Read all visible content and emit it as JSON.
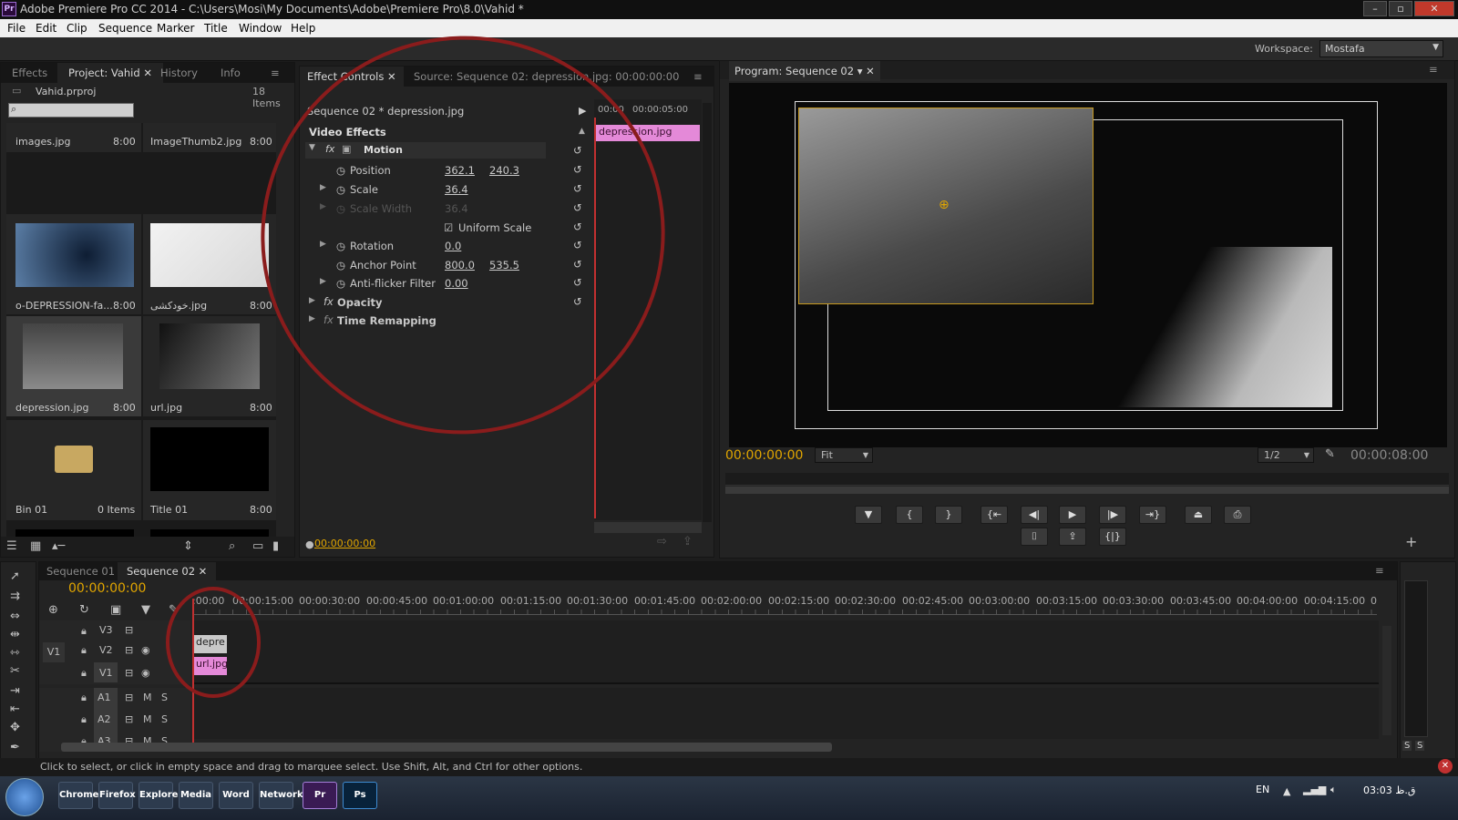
{
  "titlebar": {
    "title": "Adobe Premiere Pro CC 2014 - C:\\Users\\Mosi\\My Documents\\Adobe\\Premiere Pro\\8.0\\Vahid *",
    "app_icon": "Pr"
  },
  "menu": [
    "File",
    "Edit",
    "Clip",
    "Sequence",
    "Marker",
    "Title",
    "Window",
    "Help"
  ],
  "workspace": {
    "label": "Workspace:",
    "value": "Mostafa"
  },
  "project_panel": {
    "tabs": [
      "Effects",
      "Project: Vahid",
      "History",
      "Info"
    ],
    "project_file": "Vahid.prproj",
    "item_count": "18 Items",
    "items": [
      {
        "name": "images.jpg",
        "dur": "8:00"
      },
      {
        "name": "ImageThumb2.jpg",
        "dur": "8:00"
      },
      {
        "name": "o-DEPRESSION-fa...",
        "dur": "8:00"
      },
      {
        "name": "خودکشی.jpg",
        "dur": "8:00"
      },
      {
        "name": "depression.jpg",
        "dur": "8:00"
      },
      {
        "name": "url.jpg",
        "dur": "8:00"
      },
      {
        "name": "Bin 01",
        "dur": "0 Items"
      },
      {
        "name": "Title 01",
        "dur": "8:00"
      }
    ]
  },
  "effect_controls": {
    "tabs": [
      "Effect Controls",
      "Source: Sequence 02: depression.jpg: 00:00:00:00"
    ],
    "sequence_clip": "Sequence 02 * depression.jpg",
    "ruler": [
      "00:00",
      "00:00:05:00"
    ],
    "clip_label": "depression.jpg",
    "section": "Video Effects",
    "motion": "Motion",
    "position_label": "Position",
    "position_x": "362.1",
    "position_y": "240.3",
    "scale_label": "Scale",
    "scale": "36.4",
    "scale_width_label": "Scale Width",
    "scale_width": "36.4",
    "uniform_scale": "Uniform Scale",
    "rotation_label": "Rotation",
    "rotation": "0.0",
    "anchor_label": "Anchor Point",
    "anchor_x": "800.0",
    "anchor_y": "535.5",
    "antiflicker_label": "Anti-flicker Filter",
    "antiflicker": "0.00",
    "opacity": "Opacity",
    "time_remapping": "Time Remapping",
    "timecode": "00:00:00:00"
  },
  "program_monitor": {
    "tab": "Program: Sequence 02",
    "timecode": "00:00:00:00",
    "fit": "Fit",
    "resolution": "1/2",
    "duration": "00:00:08:00"
  },
  "timeline": {
    "tabs": [
      "Sequence 01",
      "Sequence 02"
    ],
    "timecode": "00:00:00:00",
    "ruler": [
      ":00:00",
      "00:00:15:00",
      "00:00:30:00",
      "00:00:45:00",
      "00:01:00:00",
      "00:01:15:00",
      "00:01:30:00",
      "00:01:45:00",
      "00:02:00:00",
      "00:02:15:00",
      "00:02:30:00",
      "00:02:45:00",
      "00:03:00:00",
      "00:03:15:00",
      "00:03:30:00",
      "00:03:45:00",
      "00:04:00:00",
      "00:04:15:00",
      "0"
    ],
    "video_tracks": [
      "V3",
      "V2",
      "V1"
    ],
    "source_patch": "V1",
    "audio_tracks": [
      "A1",
      "A2",
      "A3"
    ],
    "clip_v2": "depre",
    "clip_v1": "url.jpg",
    "m": "M",
    "s": "S"
  },
  "status": "Click to select, or click in empty space and drag to marquee select. Use Shift, Alt, and Ctrl for other options.",
  "meter": {
    "s1": "S",
    "s2": "S"
  },
  "taskbar": {
    "lang": "EN",
    "clock": "03:03 ق.ظ",
    "apps": [
      "Chrome",
      "Firefox",
      "Explorer",
      "Media",
      "Word",
      "Network",
      "Pr",
      "Ps"
    ]
  }
}
